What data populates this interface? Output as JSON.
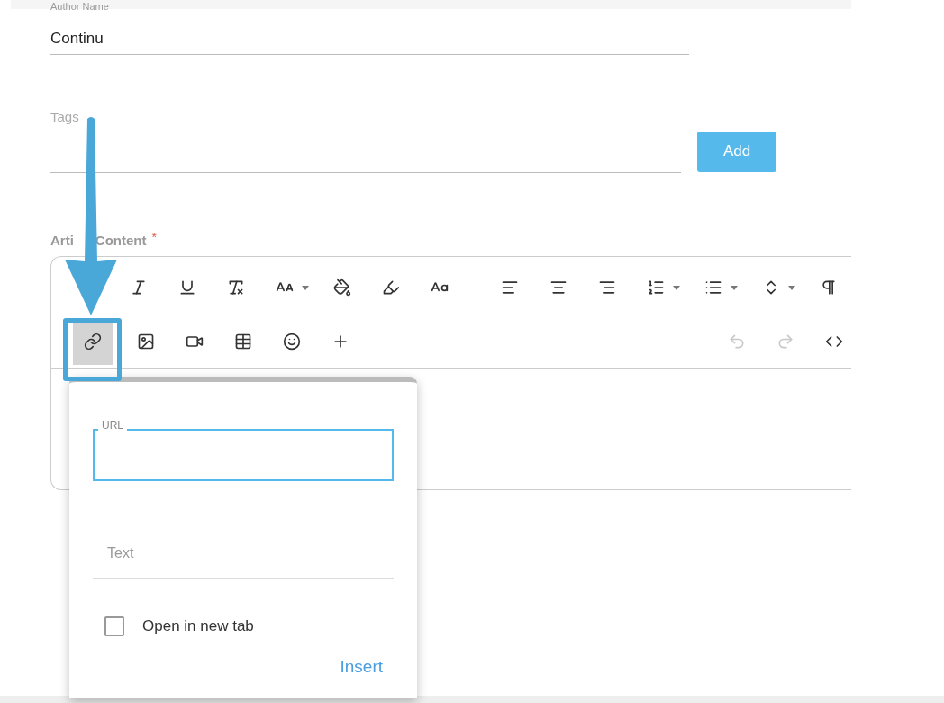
{
  "author_field": {
    "label": "Author Name",
    "value": "Continu"
  },
  "tags_field": {
    "label": "Tags",
    "button": "Add"
  },
  "content_field": {
    "label_parts": [
      "Arti",
      "Content"
    ],
    "required_mark": "*"
  },
  "toolbar": {
    "link_button": {
      "selected": true
    },
    "undo_button": {
      "disabled": true
    },
    "redo_button": {
      "disabled": true
    }
  },
  "link_dialog": {
    "url_label": "URL",
    "text_placeholder": "Text",
    "new_tab": {
      "label": "Open in new tab",
      "checked": false
    },
    "insert_button": "Insert"
  }
}
